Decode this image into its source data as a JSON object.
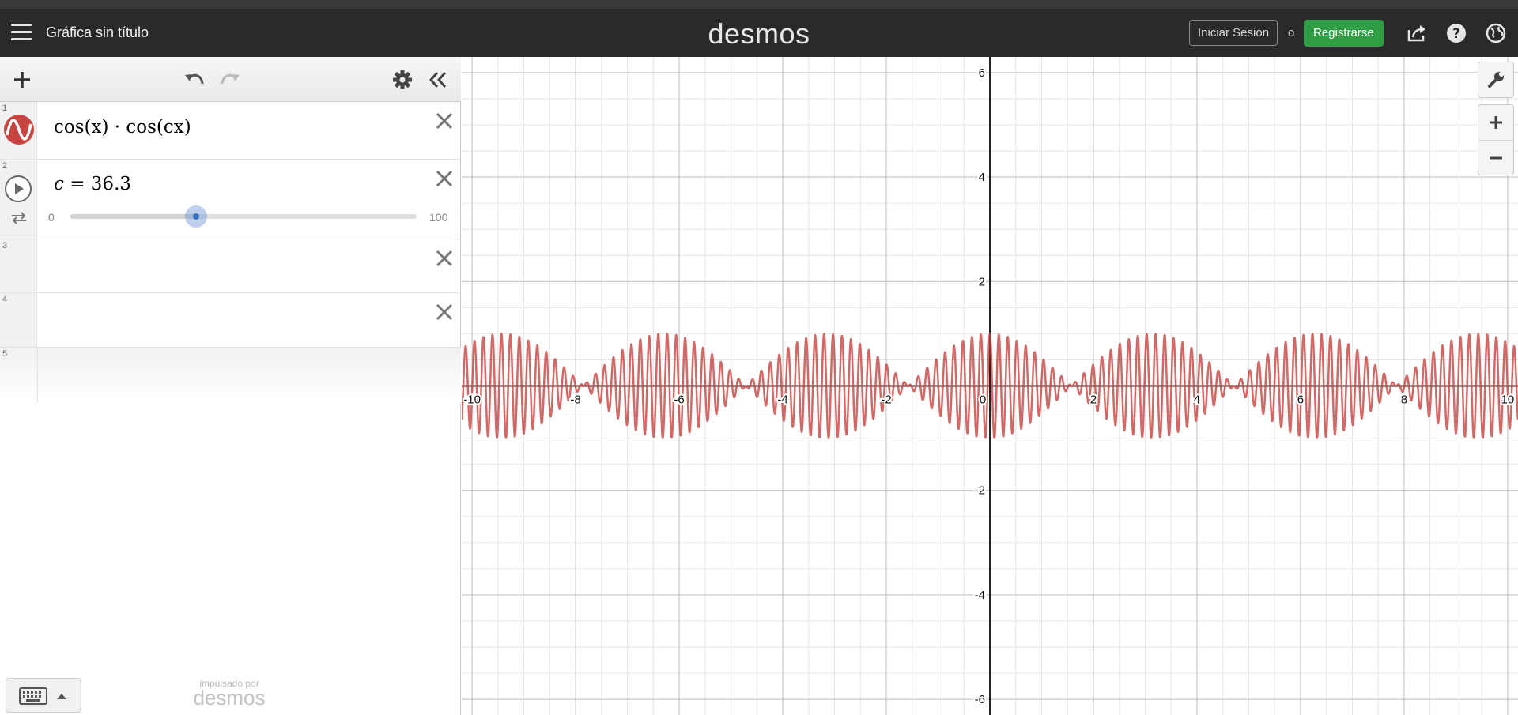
{
  "header": {
    "menu_icon": "hamburger-menu-icon",
    "title": "Gráfica sin título",
    "logo": "desmos",
    "login_label": "Iniciar Sesión",
    "or_label": "o",
    "signup_label": "Registrarse",
    "signup_color": "#2f9e44",
    "icons": [
      "share-icon",
      "help-icon",
      "language-globe-icon"
    ]
  },
  "toolbar": {
    "icons": [
      "add-item-icon",
      "undo-icon",
      "redo-icon",
      "settings-gear-icon",
      "collapse-list-icon"
    ]
  },
  "expressions": [
    {
      "index": "1",
      "latex_text": "cos(x) · cos(cx)",
      "color": "#c74440",
      "icon": "graph-curve-icon"
    },
    {
      "index": "2",
      "variable": "c",
      "value": "36.3",
      "slider": {
        "min": "0",
        "max": "100",
        "value": 36.3
      },
      "icons": [
        "play-icon",
        "loop-icon"
      ]
    },
    {
      "index": "3"
    },
    {
      "index": "4"
    },
    {
      "index": "5"
    }
  ],
  "keyboard": {
    "icon": "keyboard-icon"
  },
  "powered_by": {
    "line1": "impulsado por",
    "line2": "desmos"
  },
  "graph_controls": {
    "icons": [
      "wrench-icon",
      "zoom-in-icon",
      "zoom-out-icon"
    ]
  },
  "chart_data": {
    "type": "line",
    "function": "cos(x)*cos(c*x)",
    "parameters": {
      "c": 36.3
    },
    "xlim": [
      -10.2,
      10.2
    ],
    "ylim": [
      -6.3,
      6.3
    ],
    "x_tick_labels": [
      "-10",
      "-8",
      "-6",
      "-4",
      "-2",
      "0",
      "2",
      "4",
      "6",
      "8",
      "10"
    ],
    "y_tick_labels": [
      "6",
      "4",
      "2",
      "-2",
      "-4",
      "-6"
    ],
    "grid": true,
    "series": [
      {
        "color": "#c74440"
      }
    ]
  }
}
